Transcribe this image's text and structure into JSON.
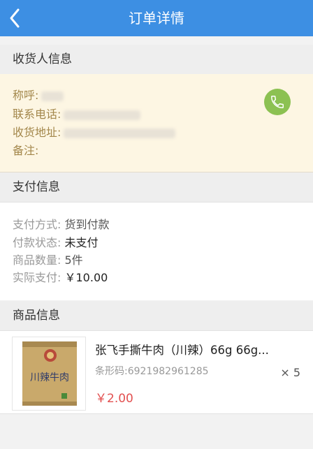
{
  "header": {
    "title": "订单详情"
  },
  "receiver": {
    "section_title": "收货人信息",
    "name_label": "称呼:",
    "phone_label": "联系电话:",
    "address_label": "收货地址:",
    "note_label": "备注:"
  },
  "payment": {
    "section_title": "支付信息",
    "method_label": "支付方式:",
    "method_value": "货到付款",
    "status_label": "付款状态:",
    "status_value": "未支付",
    "count_label": "商品数量:",
    "count_value": "5件",
    "paid_label": "实际支付:",
    "paid_value": "￥10.00"
  },
  "goods": {
    "section_title": "商品信息",
    "items": [
      {
        "name": "张飞手撕牛肉（川辣）66g 66g...",
        "barcode": "条形码:6921982961285",
        "price": "￥2.00",
        "quantity": "× 5",
        "package_text": "川辣牛肉"
      }
    ]
  },
  "colors": {
    "topbar": "#3d8fe3",
    "receiver_bg": "#fdf6e3",
    "receiver_text": "#a3874b",
    "call_button": "#8cc152",
    "price": "#e25050"
  }
}
